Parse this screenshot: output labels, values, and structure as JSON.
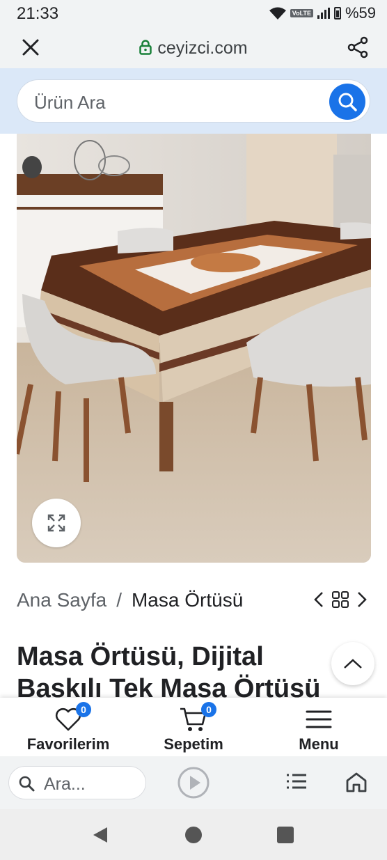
{
  "status_bar": {
    "time": "21:33",
    "network_badge": "VoLTE",
    "battery": "%59"
  },
  "url_bar": {
    "domain": "ceyizci.com"
  },
  "search": {
    "placeholder": "Ürün Ara"
  },
  "breadcrumb": {
    "home": "Ana Sayfa",
    "separator": "/",
    "current": "Masa Örtüsü"
  },
  "product": {
    "title": "Masa Örtüsü, Dijital Baskılı Tek Masa Örtüsü"
  },
  "bottom_nav": {
    "favorites": {
      "label": "Favorilerim",
      "count": "0"
    },
    "cart": {
      "label": "Sepetim",
      "count": "0"
    },
    "menu": {
      "label": "Menu"
    }
  },
  "browser_bar": {
    "search_placeholder": "Ara..."
  },
  "colors": {
    "accent": "#1a73e8",
    "header_bg": "#dbe8f8",
    "chrome_bg": "#f1f3f4"
  }
}
